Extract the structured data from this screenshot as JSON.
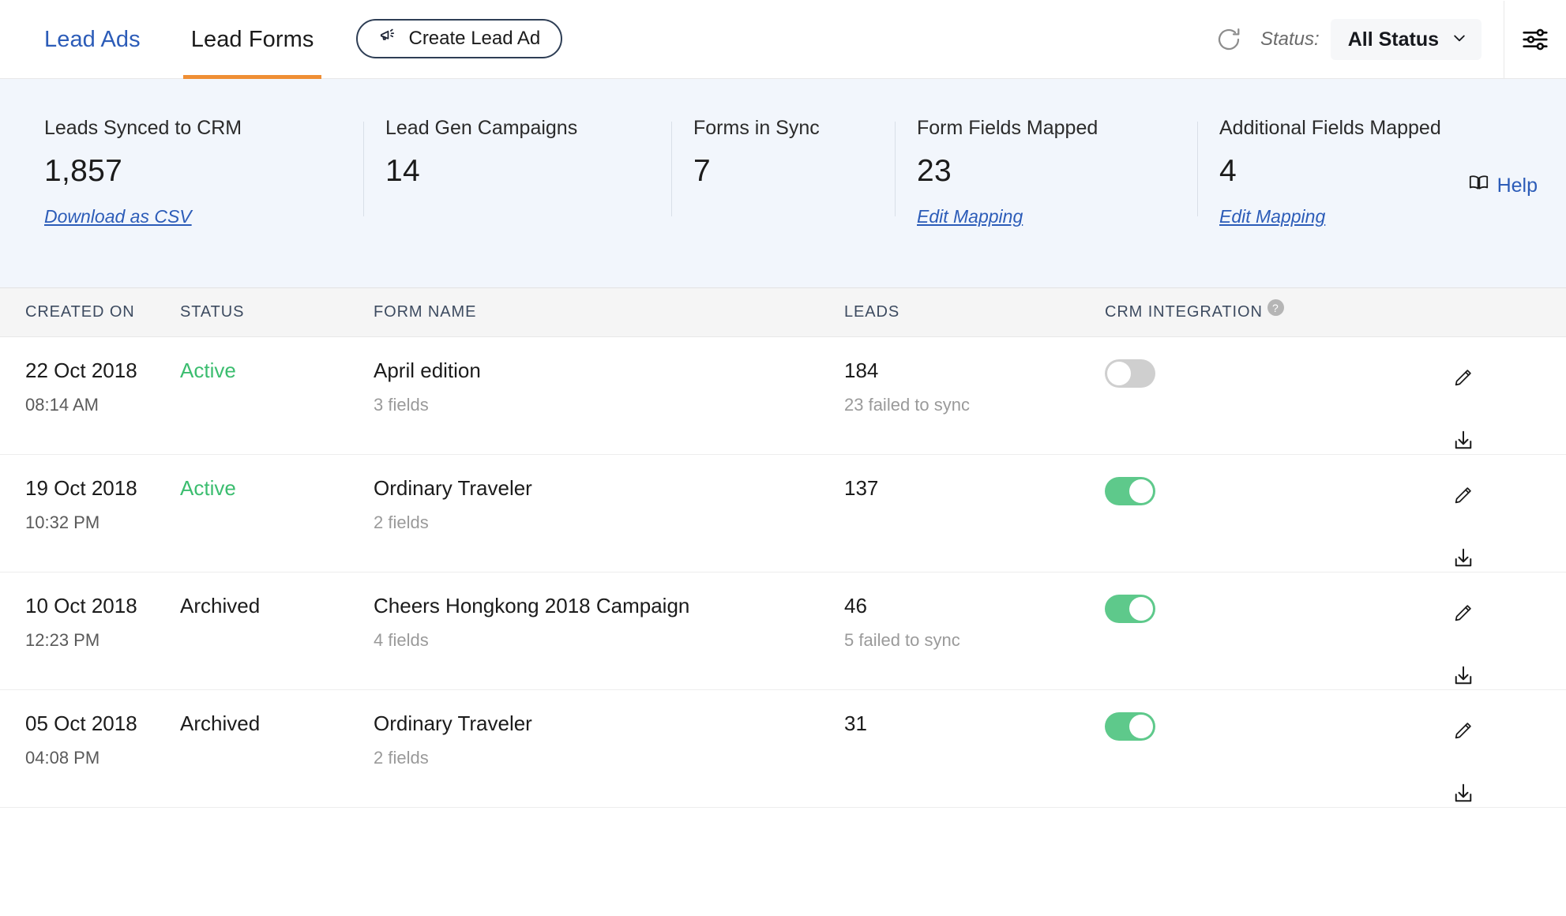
{
  "header": {
    "tabs": [
      {
        "label": "Lead Ads",
        "active": false
      },
      {
        "label": "Lead Forms",
        "active": true
      }
    ],
    "create_button": "Create Lead Ad",
    "refresh_icon": "refresh-icon",
    "status_label": "Status:",
    "status_value": "All Status",
    "status_options": [
      "All Status"
    ],
    "settings_icon": "sliders-icon"
  },
  "stats": {
    "help_label": "Help",
    "help_icon": "book-icon",
    "items": [
      {
        "label": "Leads Synced to CRM",
        "value": "1,857",
        "link": "Download as CSV"
      },
      {
        "label": "Lead Gen Campaigns",
        "value": "14",
        "link": ""
      },
      {
        "label": "Forms in Sync",
        "value": "7",
        "link": ""
      },
      {
        "label": "Form Fields Mapped",
        "value": "23",
        "link": "Edit Mapping"
      },
      {
        "label": "Additional Fields Mapped",
        "value": "4",
        "link": "Edit Mapping"
      }
    ]
  },
  "table": {
    "columns": {
      "created_on": "CREATED ON",
      "status": "STATUS",
      "form_name": "FORM NAME",
      "leads": "LEADS",
      "crm_integration": "CRM INTEGRATION",
      "crm_help_badge": "?"
    },
    "rows": [
      {
        "date": "22 Oct 2018",
        "time": "08:14 AM",
        "status": "Active",
        "status_kind": "active",
        "form_name": "April edition",
        "fields": "3 fields",
        "leads": "184",
        "failed": "23 failed to sync",
        "crm_on": false,
        "edit_icon": "pencil-icon",
        "download_icon": "download-icon"
      },
      {
        "date": "19 Oct 2018",
        "time": "10:32 PM",
        "status": "Active",
        "status_kind": "active",
        "form_name": "Ordinary Traveler",
        "fields": "2 fields",
        "leads": "137",
        "failed": "",
        "crm_on": true,
        "edit_icon": "pencil-icon",
        "download_icon": "download-icon"
      },
      {
        "date": "10 Oct 2018",
        "time": "12:23 PM",
        "status": "Archived",
        "status_kind": "archived",
        "form_name": "Cheers Hongkong 2018 Campaign",
        "fields": "4 fields",
        "leads": "46",
        "failed": "5 failed to sync",
        "crm_on": true,
        "edit_icon": "pencil-icon",
        "download_icon": "download-icon"
      },
      {
        "date": "05 Oct 2018",
        "time": "04:08 PM",
        "status": "Archived",
        "status_kind": "archived",
        "form_name": "Ordinary Traveler",
        "fields": "2 fields",
        "leads": "31",
        "failed": "",
        "crm_on": true,
        "edit_icon": "pencil-icon",
        "download_icon": "download-icon"
      }
    ]
  },
  "colors": {
    "accent_orange": "#ef8f35",
    "link_blue": "#2c5cb8",
    "status_active_green": "#3bbd6f",
    "toggle_on_green": "#5ec98b",
    "toggle_off_gray": "#cfcfcf",
    "stats_bg": "#f2f6fc",
    "table_header_bg": "#f5f5f5"
  }
}
